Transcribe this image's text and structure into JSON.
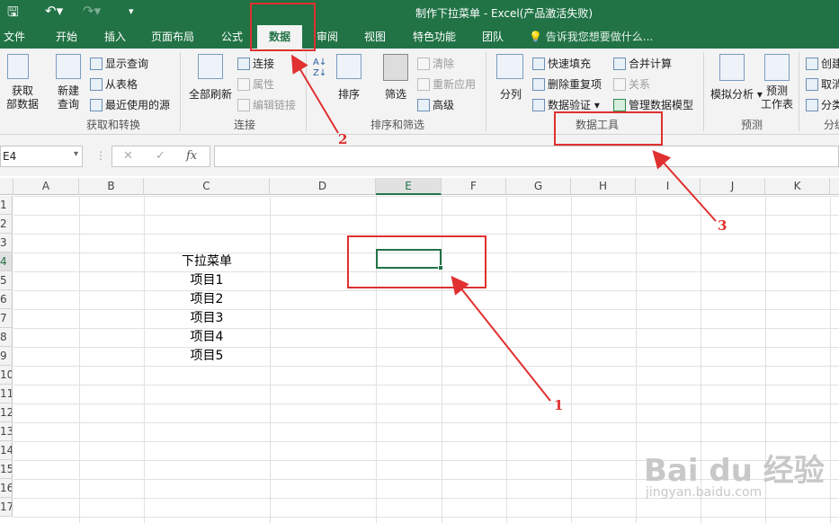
{
  "window": {
    "title": "制作下拉菜单 - Excel(产品激活失败)"
  },
  "tabs": [
    {
      "label": "文件"
    },
    {
      "label": "开始"
    },
    {
      "label": "插入"
    },
    {
      "label": "页面布局"
    },
    {
      "label": "公式"
    },
    {
      "label": "数据"
    },
    {
      "label": "审阅"
    },
    {
      "label": "视图"
    },
    {
      "label": "特色功能"
    },
    {
      "label": "团队"
    }
  ],
  "tell_me": "告诉我您想要做什么...",
  "ribbon": {
    "get_external": "获取\n部数据",
    "new_query": "新建\n查询",
    "show_queries": "显示查询",
    "from_table": "从表格",
    "recent_sources": "最近使用的源",
    "group_get_transform": "获取和转换",
    "refresh_all": "全部刷新",
    "connections": "连接",
    "properties": "属性",
    "edit_links": "编辑链接",
    "group_connections": "连接",
    "sort": "排序",
    "filter": "筛选",
    "clear": "清除",
    "reapply": "重新应用",
    "advanced": "高级",
    "group_sort_filter": "排序和筛选",
    "text_to_columns": "分列",
    "flash_fill": "快速填充",
    "remove_duplicates": "删除重复项",
    "data_validation": "数据验证",
    "consolidate": "合并计算",
    "relationships": "关系",
    "manage_data_model": "管理数据模型",
    "group_data_tools": "数据工具",
    "what_if": "模拟分析",
    "forecast_sheet": "预测\n工作表",
    "group_forecast": "预测",
    "create_group": "创建",
    "ungroup": "取消",
    "subtotal": "分类",
    "group_outline": "分级"
  },
  "formula_bar": {
    "name_box": "E4",
    "fx": "fx",
    "formula": ""
  },
  "columns": [
    "A",
    "B",
    "C",
    "D",
    "E",
    "F",
    "G",
    "H",
    "I",
    "J",
    "K"
  ],
  "rows": [
    "1",
    "2",
    "3",
    "4",
    "5",
    "6",
    "7",
    "8",
    "9",
    "10",
    "11",
    "12",
    "13",
    "14",
    "15",
    "16",
    "17"
  ],
  "cells": [
    {
      "col": "C",
      "row": "4",
      "value": "下拉菜单"
    },
    {
      "col": "C",
      "row": "5",
      "value": "项目1"
    },
    {
      "col": "C",
      "row": "6",
      "value": "项目2"
    },
    {
      "col": "C",
      "row": "7",
      "value": "项目3"
    },
    {
      "col": "C",
      "row": "8",
      "value": "项目4"
    },
    {
      "col": "C",
      "row": "9",
      "value": "项目5"
    }
  ],
  "selected_cell": "E4",
  "annotations": [
    {
      "label": "1"
    },
    {
      "label": "2"
    },
    {
      "label": "3"
    }
  ],
  "watermark": {
    "text": "Bai du 经验",
    "url": "jingyan.baidu.com"
  },
  "colors": {
    "excel_green": "#217346",
    "annotation_red": "#e03030"
  }
}
